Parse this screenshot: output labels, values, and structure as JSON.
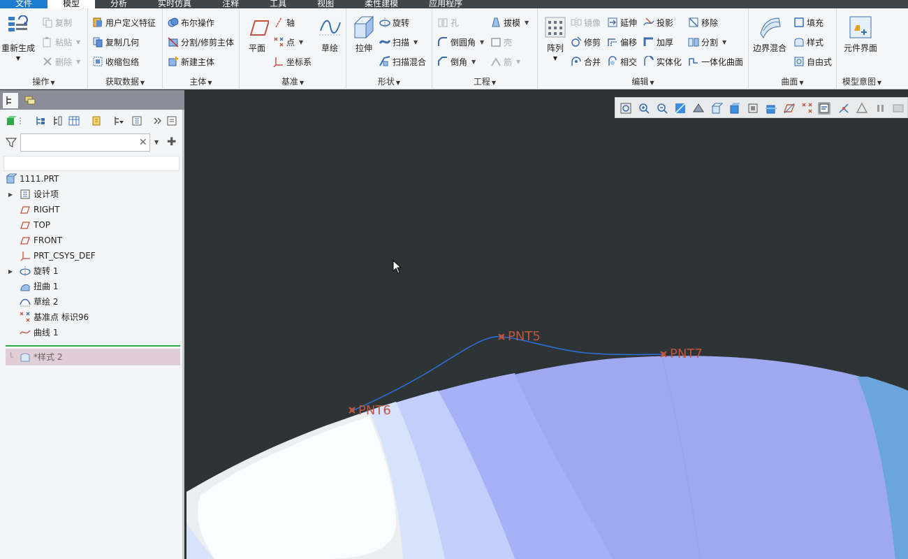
{
  "menubar": {
    "items": [
      "文件",
      "模型",
      "分析",
      "实时仿真",
      "注释",
      "工具",
      "视图",
      "柔性建模",
      "应用程序"
    ],
    "active": "模型"
  },
  "ribbon": {
    "operations": {
      "label": "操作",
      "regenerate": "重新生成",
      "copy": "复制",
      "paste": "粘贴",
      "delete": "删除"
    },
    "get_data": {
      "label": "获取数据",
      "udf": "用户定义特征",
      "copy_geom": "复制几何",
      "shrinkwrap": "收缩包络"
    },
    "body": {
      "label": "主体",
      "boolean": "布尔操作",
      "split_trim": "分割/修剪主体",
      "new_body": "新建主体"
    },
    "datum": {
      "label": "基准",
      "plane": "平面",
      "axis": "轴",
      "point": "点",
      "csys": "坐标系",
      "sketch": "草绘"
    },
    "shapes": {
      "label": "形状",
      "extrude": "拉伸",
      "revolve": "旋转",
      "sweep": "扫描",
      "swept_blend": "扫描混合"
    },
    "engineering": {
      "label": "工程",
      "hole": "孔",
      "round": "倒圆角",
      "chamfer": "倒角",
      "draft": "拔模",
      "shell": "壳",
      "rib": "筋"
    },
    "editing": {
      "label": "编辑",
      "pattern": "阵列",
      "mirror": "镜像",
      "extend": "延伸",
      "project": "投影",
      "move": "移除",
      "trim": "修剪",
      "offset": "偏移",
      "thicken": "加厚",
      "split": "分割",
      "merge": "合并",
      "intersect": "相交",
      "solidify": "实体化",
      "quilt_curve": "一体化曲面"
    },
    "surfaces": {
      "label": "曲面",
      "boundary_blend": "边界混合",
      "fill": "填充",
      "style": "样式",
      "freestyle": "自由式"
    },
    "model_intent": {
      "label": "模型意图",
      "component_interface": "元件界面"
    }
  },
  "tree": {
    "search_placeholder": "",
    "items": [
      {
        "label": "1111.PRT",
        "icon": "part-icon"
      },
      {
        "label": "设计项",
        "icon": "design-items-icon"
      },
      {
        "label": "RIGHT",
        "icon": "datum-plane-icon"
      },
      {
        "label": "TOP",
        "icon": "datum-plane-icon"
      },
      {
        "label": "FRONT",
        "icon": "datum-plane-icon"
      },
      {
        "label": "PRT_CSYS_DEF",
        "icon": "csys-icon"
      },
      {
        "label": "旋转 1",
        "icon": "revolve-icon"
      },
      {
        "label": "扭曲 1",
        "icon": "warp-icon"
      },
      {
        "label": "草绘 2",
        "icon": "sketch-icon"
      },
      {
        "label": "基准点 标识96",
        "icon": "datum-point-icon"
      },
      {
        "label": "曲线 1",
        "icon": "curve-icon"
      }
    ],
    "insert_item": "*样式 2"
  },
  "points": {
    "pnt5": "PNT5",
    "pnt6": "PNT6",
    "pnt7": "PNT7"
  },
  "colors": {
    "accent": "#1f7bd0",
    "viewport_bg": "#2e3436",
    "curve": "#2a6fd6",
    "point_label": "#c2553f",
    "insert_line": "#2ea84a"
  }
}
